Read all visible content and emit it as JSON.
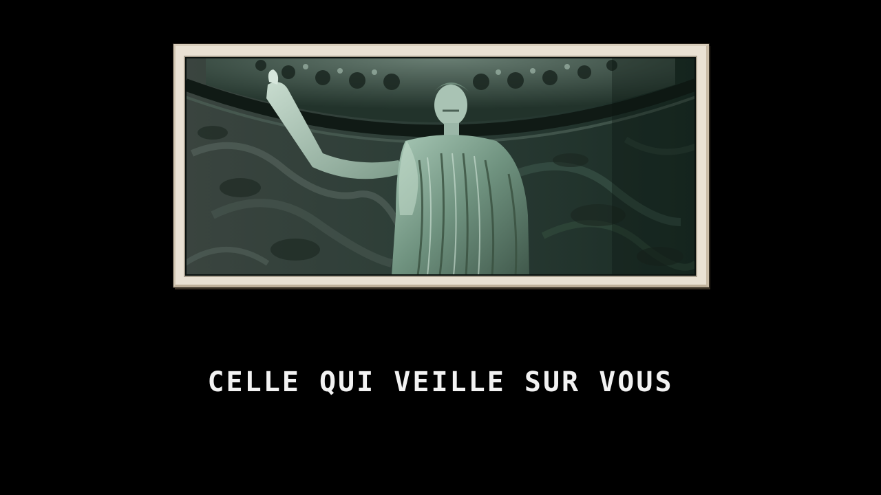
{
  "scene": {
    "picture_icon": "statue-photo",
    "caption": "CELLE QUI VEILLE SUR VOUS"
  },
  "colors": {
    "background": "#000000",
    "frame_paper": "#e9e1d3",
    "photo_tint_dark": "#16261f",
    "photo_tint_light": "#c9e4d3",
    "caption_text": "#f2f2f2"
  }
}
